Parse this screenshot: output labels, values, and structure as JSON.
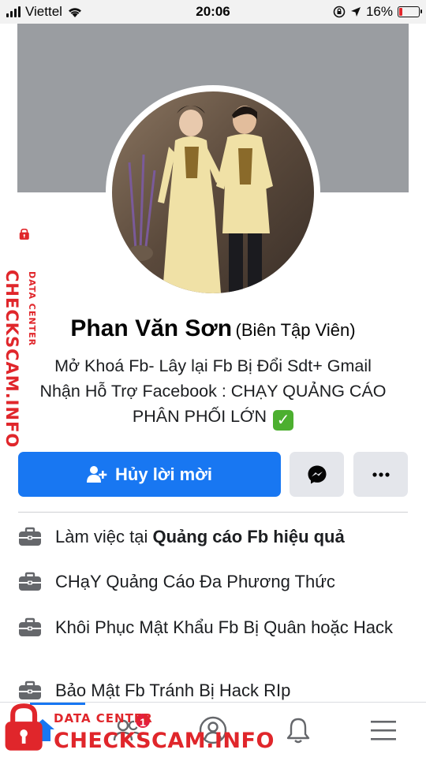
{
  "status_bar": {
    "carrier": "Viettel",
    "time": "20:06",
    "battery_percent": "16%",
    "battery_level": 0.16
  },
  "profile": {
    "name": "Phan Văn Sơn",
    "role": "(Biên Tập Viên)",
    "bio_line1": "Mở Khoá Fb- Lây lại Fb Bị Đổi Sdt+ Gmail",
    "bio_line2": "Nhận Hỗ Trợ Facebook : CHẠY QUẢNG CÁO",
    "bio_line3": "PHÂN PHỐI LỚN"
  },
  "actions": {
    "primary_label": "Hủy lời mời"
  },
  "about": [
    {
      "icon": "briefcase-icon",
      "prefix": "Làm việc tại ",
      "bold": "Quảng cáo Fb hiệu quả"
    },
    {
      "icon": "briefcase-icon",
      "text": "CHạY Quảng Cáo Đa Phương Thức"
    },
    {
      "icon": "briefcase-icon",
      "text": "Khôi Phục Mật Khẩu Fb Bị Quân hoặc Hack"
    },
    {
      "icon": "briefcase-icon",
      "text": "Bảo Mật Fb Tránh Bị Hack RIp"
    }
  ],
  "bottom_nav": {
    "friends_badge": "1",
    "active": "home"
  },
  "watermark": {
    "brand": "CHECKSCAM.INFO",
    "tag": "DATA CENTER"
  },
  "colors": {
    "primary": "#1877f2",
    "watermark": "#e0262b",
    "badge": "#e41e3f"
  }
}
